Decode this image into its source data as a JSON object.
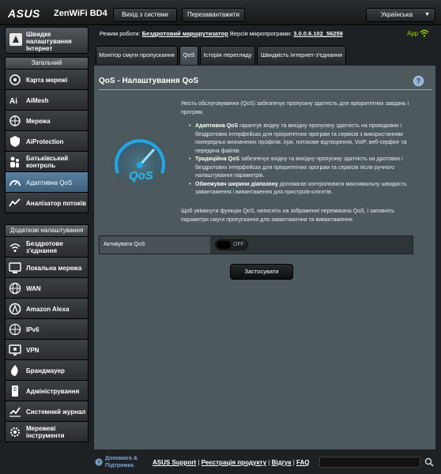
{
  "header": {
    "brand": "ASUS",
    "model": "ZenWiFi BD4",
    "logout_label": "Вихід з системи",
    "reboot_label": "Перезавантажити",
    "language": "Українська"
  },
  "sidebar": {
    "quick_setup": "Швидке налаштування Інтернет",
    "general_heading": "Загальний",
    "general_items": [
      {
        "label": "Карта мережі",
        "icon": "network-map-icon"
      },
      {
        "label": "AiMesh",
        "icon": "aimesh-icon"
      },
      {
        "label": "Мережа",
        "icon": "network-icon"
      },
      {
        "label": "AiProtection",
        "icon": "aiprotection-icon"
      },
      {
        "label": "Батьківський контроль",
        "icon": "parental-control-icon"
      },
      {
        "label": "Адаптивна QoS",
        "icon": "qos-icon",
        "active": true
      },
      {
        "label": "Аналізатор потоків",
        "icon": "traffic-analyzer-icon"
      }
    ],
    "advanced_heading": "Додаткові налаштування",
    "advanced_items": [
      {
        "label": "Бездротове з'єднання",
        "icon": "wireless-icon"
      },
      {
        "label": "Локальна мережа",
        "icon": "lan-icon"
      },
      {
        "label": "WAN",
        "icon": "wan-icon"
      },
      {
        "label": "Amazon Alexa",
        "icon": "alexa-icon"
      },
      {
        "label": "IPv6",
        "icon": "ipv6-icon"
      },
      {
        "label": "VPN",
        "icon": "vpn-icon"
      },
      {
        "label": "Брандмауер",
        "icon": "firewall-icon"
      },
      {
        "label": "Адміністрування",
        "icon": "administration-icon"
      },
      {
        "label": "Системний журнал",
        "icon": "system-log-icon"
      },
      {
        "label": "Мережеві інструменти",
        "icon": "network-tools-icon"
      }
    ]
  },
  "status": {
    "mode_label": "Режим роботи:",
    "mode_value": "Бездротовий маршрутизатор",
    "fw_label": "Версія мікропрограми:",
    "fw_value": "3.0.0.6.102_56259",
    "app_label": "App"
  },
  "tabs": [
    {
      "label": "Монітор смуги пропускання"
    },
    {
      "label": "QoS",
      "active": true
    },
    {
      "label": "Історія перегляду"
    },
    {
      "label": "Швидкість Інтернет-з'єднання"
    }
  ],
  "panel": {
    "title": "QoS - Налаштування QoS",
    "help": "?",
    "intro": "Якість обслуговування (QoS) забезпечує пропускну здатність для пріоритетних завдань і програм.",
    "bullets": [
      {
        "title": "Адаптивна QoS",
        "text": "гарантує вхідну та вихідну пропускну здатність на проводових і бездротових інтерфейсах для пріоритетних програм та сервісів з використанням попередньо визначених профілів: ігри, потокове відтворення, VoIP, веб-серфінг та передача файлів."
      },
      {
        "title": "Традиційна QoS",
        "text": "забезпечує вхідну та вихідну пропускну здатність на дротових і бездротових інтерфейсах для пріоритетних програм та сервісів після ручного налаштування параметрів."
      },
      {
        "title": "Обмежувач ширини діапазону",
        "text": "допомагає контролювати максимальну швидкість завантаження і вивантаження для пристроїв-клієнтів."
      }
    ],
    "note": "Щоб увімкнути функцію QoS, натисніть на зображенні перемикача QoS, і заповніть параметри смуги пропускання для завантаження та вивантаження.",
    "enable_label": "Активувати QoS",
    "toggle_state": "OFF",
    "apply_label": "Застосувати"
  },
  "footer": {
    "help_label": "Допомога & Підтримка",
    "links": [
      "ASUS Support",
      "Реєстрація продукту",
      "Відгук",
      "FAQ"
    ],
    "separator": " | "
  },
  "colors": {
    "background": "#1e2124",
    "panel": "#4d595d",
    "active_nav": "#4a7090",
    "accent_green": "#93d400",
    "link_blue": "#7fa3cf"
  }
}
